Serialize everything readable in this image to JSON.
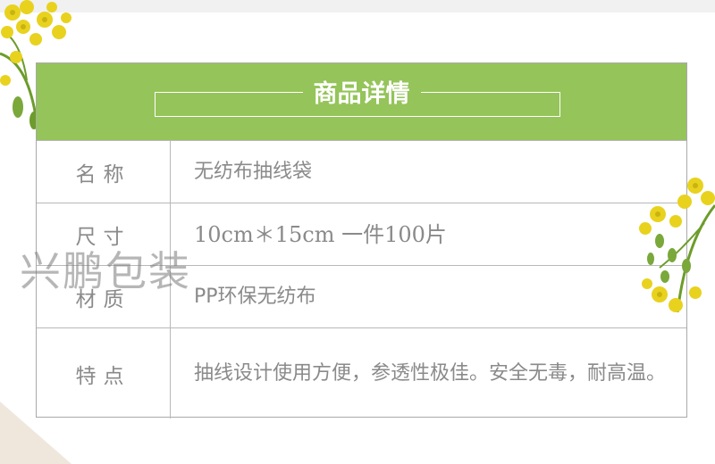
{
  "header": {
    "title": "商品详情"
  },
  "rows": [
    {
      "label": "名称",
      "value": "无纺布抽线袋"
    },
    {
      "label": "尺寸",
      "value": "10cm＊15cm 一件100片"
    },
    {
      "label": "材质",
      "value": "PP环保无纺布"
    },
    {
      "label": "特点",
      "value": "抽线设计使用方便，参透性极佳。安全无毒，耐高温。"
    }
  ],
  "watermark": "兴鹏包装",
  "colors": {
    "header_bg": "#95c45a",
    "text": "#8a8a8a",
    "border": "#b8b8b8",
    "flower": "#e8d21e",
    "leaf": "#6d9c2a"
  }
}
